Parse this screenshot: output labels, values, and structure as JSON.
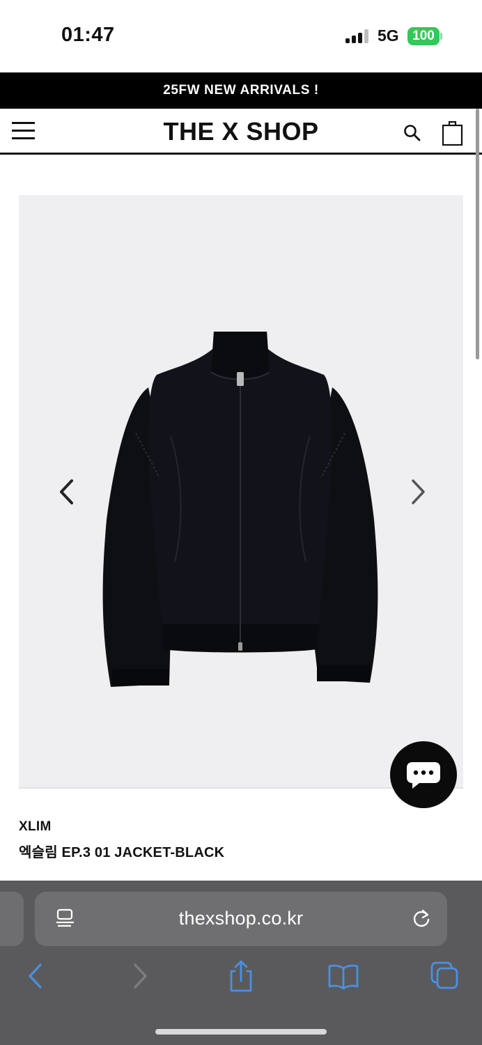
{
  "status_bar": {
    "time": "01:47",
    "network": "5G",
    "battery": "100"
  },
  "announcement": "25FW NEW ARRIVALS !",
  "header": {
    "logo": "THE X SHOP"
  },
  "product": {
    "brand": "XLIM",
    "name": "엑슬림 EP.3 01 JACKET-BLACK"
  },
  "browser": {
    "url": "thexshop.co.kr"
  },
  "colors": {
    "announce_bg": "#000000",
    "battery": "#34c759",
    "safari_bar": "#5a5a5c",
    "toolbar_icon": "#4a90e2"
  }
}
